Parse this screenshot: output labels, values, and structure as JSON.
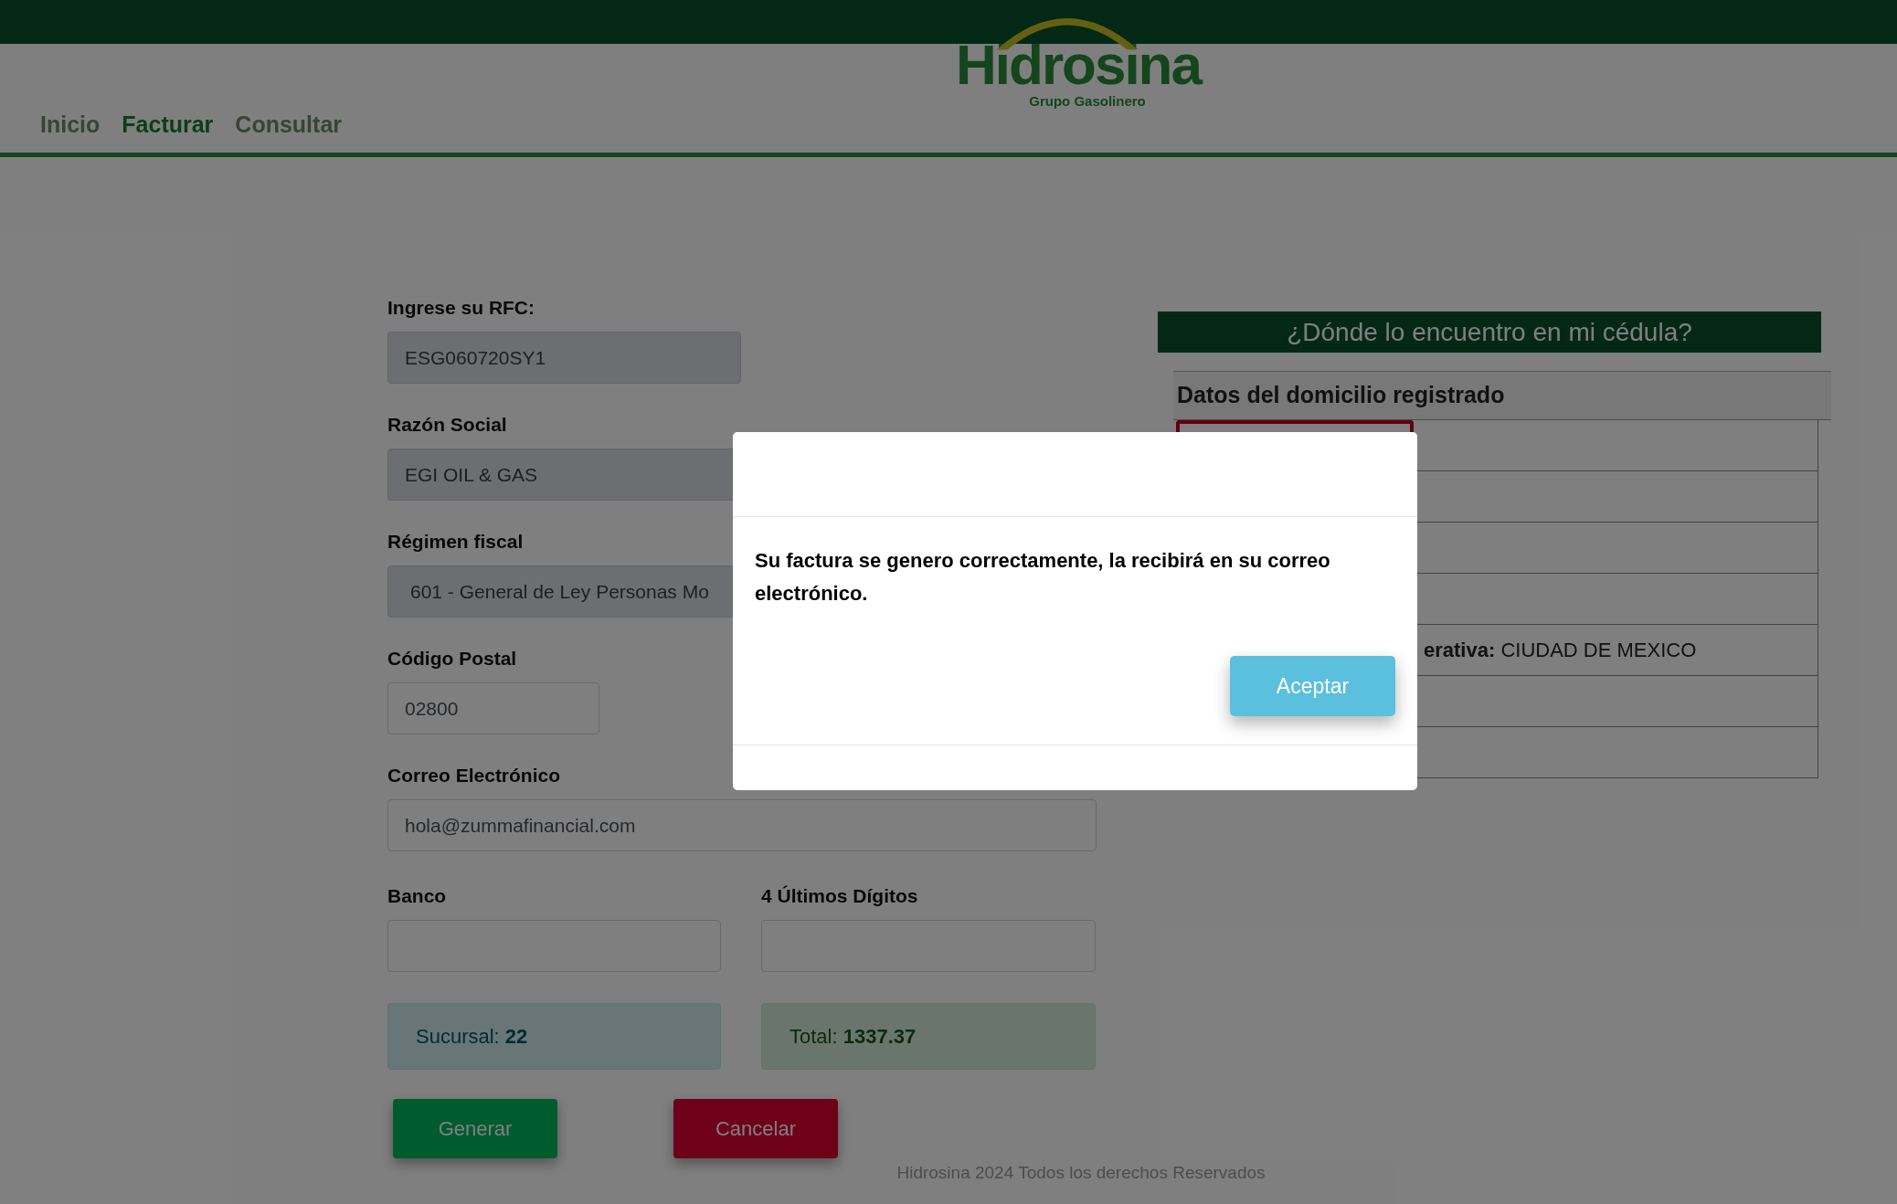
{
  "header": {
    "logo": {
      "name": "Hidrosina",
      "tagline": "Grupo Gasolinero"
    },
    "nav": [
      {
        "label": "Inicio",
        "selected": false
      },
      {
        "label": "Facturar",
        "selected": true
      },
      {
        "label": "Consultar",
        "selected": false
      }
    ]
  },
  "form": {
    "rfc": {
      "label": "Ingrese su RFC:",
      "value": "ESG060720SY1",
      "disabled": true
    },
    "razon_social": {
      "label": "Razón Social",
      "value": "EGI OIL & GAS",
      "disabled": true
    },
    "regimen_fiscal": {
      "label": "Régimen fiscal",
      "value": "601 - General de Ley Personas Mo",
      "disabled": true
    },
    "codigo_postal": {
      "label": "Código Postal",
      "value": "02800",
      "disabled": false
    },
    "correo": {
      "label": "Correo Electrónico",
      "value": "hola@zummafinancial.com",
      "disabled": false
    },
    "banco": {
      "label": "Banco",
      "disabled": false
    },
    "ultimos_digitos": {
      "label": "4 Últimos Dígitos",
      "disabled": false
    },
    "sucursal": {
      "label": "Sucursal:",
      "value": "22"
    },
    "total": {
      "label": "Total:",
      "value": "1337.37"
    },
    "buttons": [
      {
        "label": "Generar",
        "kind": "primary"
      },
      {
        "label": "Cancelar",
        "kind": "danger"
      }
    ]
  },
  "help": {
    "title": "¿Dónde lo encuentro en mi cédula?",
    "document": {
      "heading": "Datos del domicilio registrado",
      "visible_line": {
        "label": "erativa:",
        "value": "CIUDAD DE MEXICO"
      }
    }
  },
  "footer": "Hidrosina 2024 Todos los derechos Reservados",
  "modal": {
    "message": "Su factura se genero correctamente, la recibirá en su correo electrónico.",
    "button": "Aceptar"
  }
}
